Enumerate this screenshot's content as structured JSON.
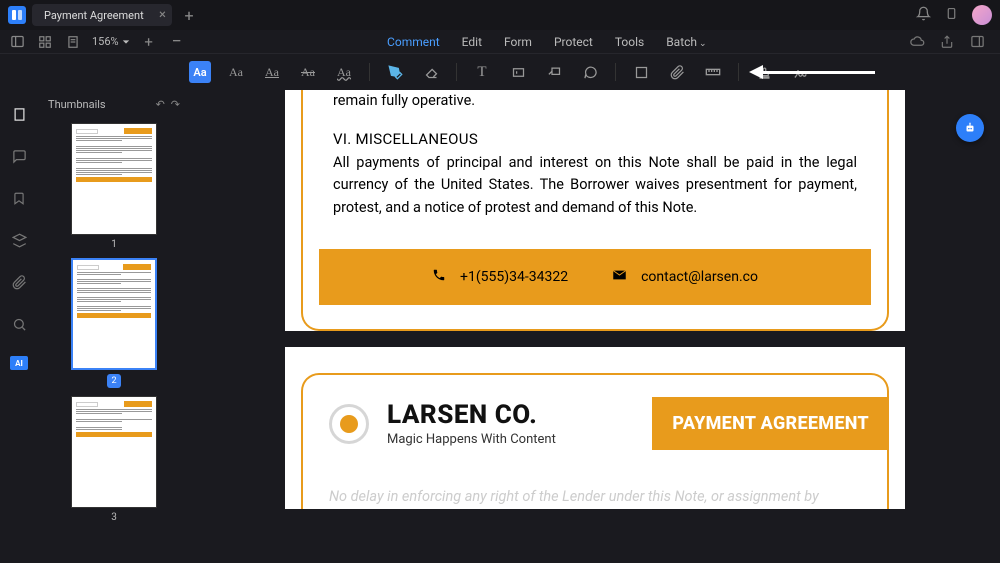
{
  "titlebar": {
    "tab_title": "Payment Agreement"
  },
  "toolbar": {
    "zoom": "156%",
    "menu": {
      "comment": "Comment",
      "edit": "Edit",
      "form": "Form",
      "protect": "Protect",
      "tools": "Tools",
      "batch": "Batch"
    }
  },
  "thumbnails": {
    "header": "Thumbnails",
    "pages": [
      "1",
      "2",
      "3"
    ]
  },
  "leftbar": {
    "ai": "AI"
  },
  "doc": {
    "p2_tail": {
      "line1": "remain fully operative.",
      "h6": "VI. MISCELLANEOUS",
      "para6": "All payments of principal and interest on this Note shall be paid in the legal currency of the United States. The Borrower waives presentment for payment, protest, and a notice of protest and demand of this Note.",
      "phone": "+1(555)34-34322",
      "email": "contact@larsen.co"
    },
    "p3_head": {
      "brand": "LARSEN CO.",
      "tagline": "Magic Happens With Content",
      "badge": "PAYMENT AGREEMENT",
      "intro": "No delay in enforcing any right of the Lender under this Note, or assignment by"
    }
  }
}
